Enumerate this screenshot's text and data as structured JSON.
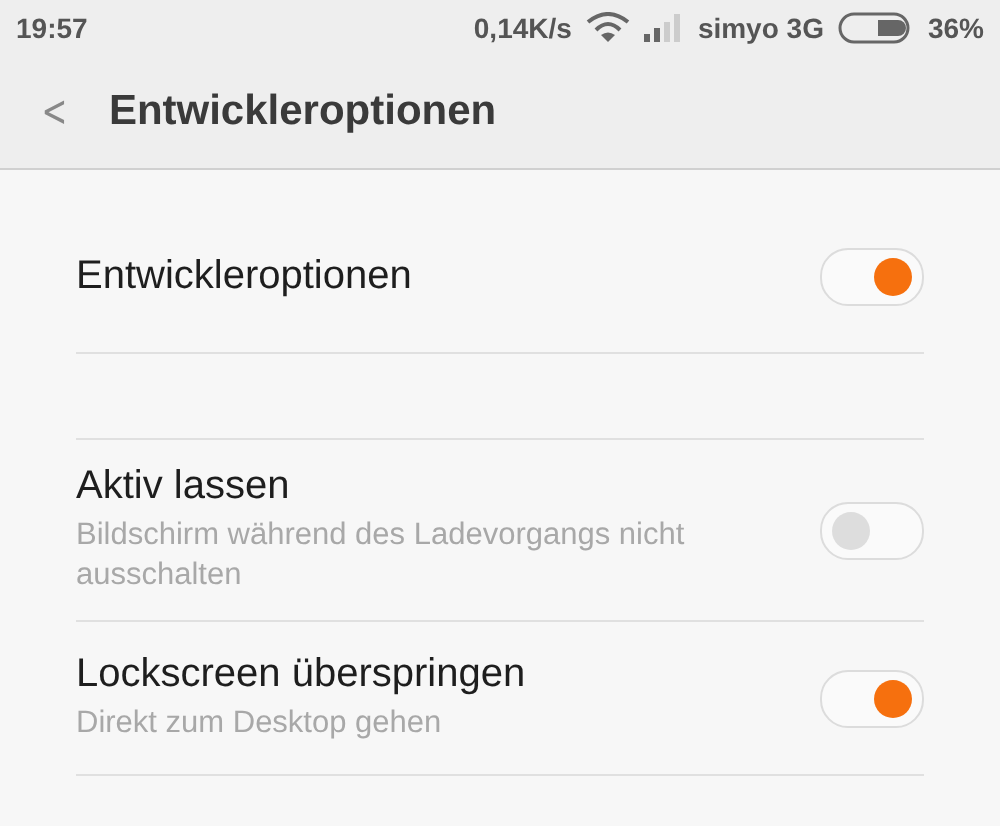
{
  "status_bar": {
    "time": "19:57",
    "speed": "0,14K/s",
    "carrier": "simyo 3G",
    "battery": "36%"
  },
  "header": {
    "back": "<",
    "title": "Entwickleroptionen"
  },
  "sections": [
    {
      "rows": [
        {
          "kind": "toggle",
          "title": "Entwickleroptionen",
          "on": true
        }
      ]
    },
    {
      "rows": [
        {
          "kind": "toggle",
          "title": "Aktiv lassen",
          "subtitle": "Bildschirm während des Ladevorgangs nicht ausschalten",
          "on": false
        },
        {
          "kind": "toggle",
          "title": "Lockscreen überspringen",
          "subtitle": "Direkt zum Desktop gehen",
          "on": true
        }
      ]
    }
  ]
}
